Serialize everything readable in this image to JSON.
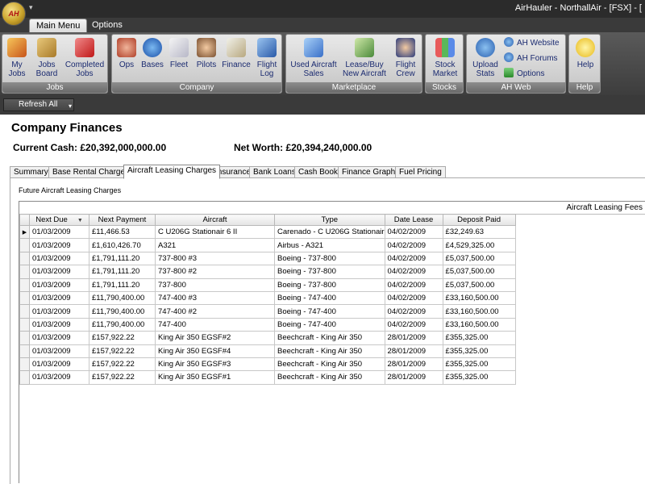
{
  "app": {
    "title": "AirHauler - NorthallAir - [FSX] - [",
    "orb_label": "AH"
  },
  "ribbon_tabs": [
    "Main Menu",
    "Options"
  ],
  "ribbon": {
    "groups": [
      {
        "label": "Jobs",
        "buttons": [
          "My\nJobs",
          "Jobs\nBoard",
          "Completed\nJobs"
        ]
      },
      {
        "label": "Company",
        "buttons": [
          "Ops",
          "Bases",
          "Fleet",
          "Pilots",
          "Finance",
          "Flight\nLog"
        ]
      },
      {
        "label": "Marketplace",
        "buttons": [
          "Used Aircraft\nSales",
          "Lease/Buy\nNew Aircraft",
          "Flight\nCrew"
        ]
      },
      {
        "label": "Stocks",
        "buttons": [
          "Stock\nMarket"
        ]
      },
      {
        "label": "AH Web",
        "buttons": [
          "Upload\nStats"
        ],
        "small": [
          "AH Website",
          "AH Forums",
          "Options"
        ]
      },
      {
        "label": "Help",
        "buttons": [
          "Help"
        ]
      }
    ]
  },
  "toolbar": {
    "refresh_label": "Refresh All"
  },
  "page": {
    "title": "Company Finances",
    "current_cash_label": "Current Cash:",
    "current_cash": "£20,392,000,000.00",
    "net_worth_label": "Net Worth:",
    "net_worth": "£20,394,240,000.00"
  },
  "tabs": [
    "Summary",
    "Base Rental Charges",
    "Aircraft Leasing Charges",
    "Insurance",
    "Bank Loans",
    "Cash Book",
    "Finance Graphs",
    "Fuel Pricing"
  ],
  "active_tab": "Aircraft Leasing Charges",
  "section_title": "Future Aircraft Leasing Charges",
  "grid": {
    "caption": "Aircraft Leasing Fees",
    "columns": [
      "Next Due",
      "Next Payment",
      "Aircraft",
      "Type",
      "Date Lease",
      "Deposit Paid"
    ],
    "rows": [
      [
        "01/03/2009",
        "£11,466.53",
        "C U206G Stationair 6 II",
        "Carenado - C U206G Stationair",
        "04/02/2009",
        "£32,249.63"
      ],
      [
        "01/03/2009",
        "£1,610,426.70",
        "A321",
        "Airbus - A321",
        "04/02/2009",
        "£4,529,325.00"
      ],
      [
        "01/03/2009",
        "£1,791,111.20",
        "737-800 #3",
        "Boeing - 737-800",
        "04/02/2009",
        "£5,037,500.00"
      ],
      [
        "01/03/2009",
        "£1,791,111.20",
        "737-800 #2",
        "Boeing - 737-800",
        "04/02/2009",
        "£5,037,500.00"
      ],
      [
        "01/03/2009",
        "£1,791,111.20",
        "737-800",
        "Boeing - 737-800",
        "04/02/2009",
        "£5,037,500.00"
      ],
      [
        "01/03/2009",
        "£11,790,400.00",
        "747-400 #3",
        "Boeing - 747-400",
        "04/02/2009",
        "£33,160,500.00"
      ],
      [
        "01/03/2009",
        "£11,790,400.00",
        "747-400 #2",
        "Boeing - 747-400",
        "04/02/2009",
        "£33,160,500.00"
      ],
      [
        "01/03/2009",
        "£11,790,400.00",
        "747-400",
        "Boeing - 747-400",
        "04/02/2009",
        "£33,160,500.00"
      ],
      [
        "01/03/2009",
        "£157,922.22",
        "King Air 350 EGSF#2",
        "Beechcraft - King Air 350",
        "28/01/2009",
        "£355,325.00"
      ],
      [
        "01/03/2009",
        "£157,922.22",
        "King Air 350 EGSF#4",
        "Beechcraft - King Air 350",
        "28/01/2009",
        "£355,325.00"
      ],
      [
        "01/03/2009",
        "£157,922.22",
        "King Air 350 EGSF#3",
        "Beechcraft - King Air 350",
        "28/01/2009",
        "£355,325.00"
      ],
      [
        "01/03/2009",
        "£157,922.22",
        "King Air 350 EGSF#1",
        "Beechcraft - King Air 350",
        "28/01/2009",
        "£355,325.00"
      ]
    ],
    "selected_row": 0
  }
}
